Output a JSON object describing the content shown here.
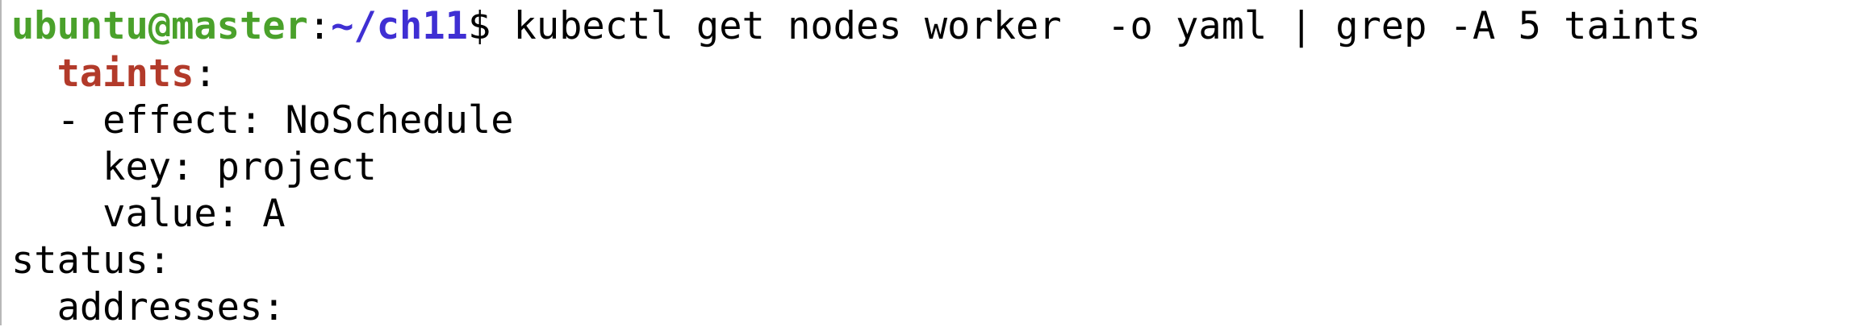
{
  "terminal": {
    "prompt": {
      "user_host": "ubuntu@master",
      "colon": ":",
      "path": "~/ch11",
      "symbol": "$ ",
      "command": "kubectl get nodes worker  -o yaml | grep -A 5 taints"
    },
    "output": [
      {
        "indent": "  ",
        "key": "taints",
        "rest": ":"
      },
      {
        "text": "  - effect: NoSchedule"
      },
      {
        "text": "    key: project"
      },
      {
        "text": "    value: A"
      },
      {
        "text": "status:"
      },
      {
        "text": "  addresses:"
      }
    ]
  },
  "colors": {
    "prompt_user": "#4aa12b",
    "prompt_path": "#3f2fd3",
    "highlight": "#b23a2a",
    "background": "#ffffff",
    "text": "#000000"
  }
}
